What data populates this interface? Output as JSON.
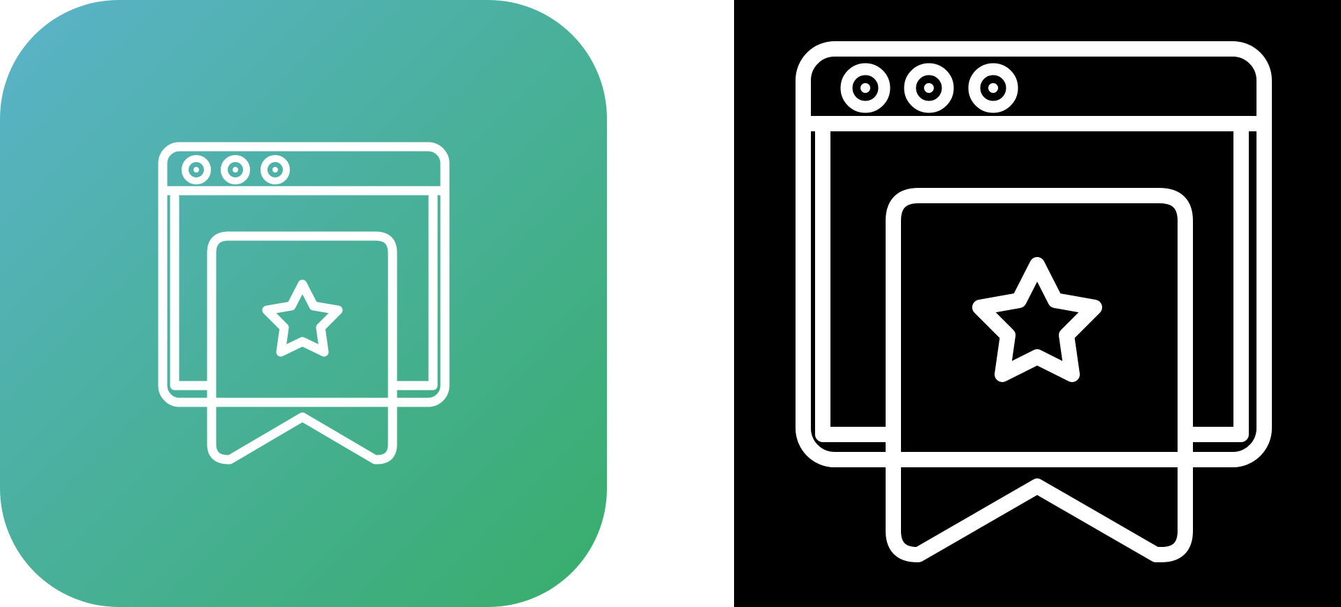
{
  "icons": [
    {
      "name": "web-bookmark-gradient-icon",
      "style": "gradient",
      "background_colors": [
        "#5ab3c9",
        "#38ad6a"
      ],
      "stroke_color": "#ffffff"
    },
    {
      "name": "web-bookmark-glyph-icon",
      "style": "black",
      "background_colors": [
        "#000000"
      ],
      "stroke_color": "#ffffff"
    }
  ]
}
